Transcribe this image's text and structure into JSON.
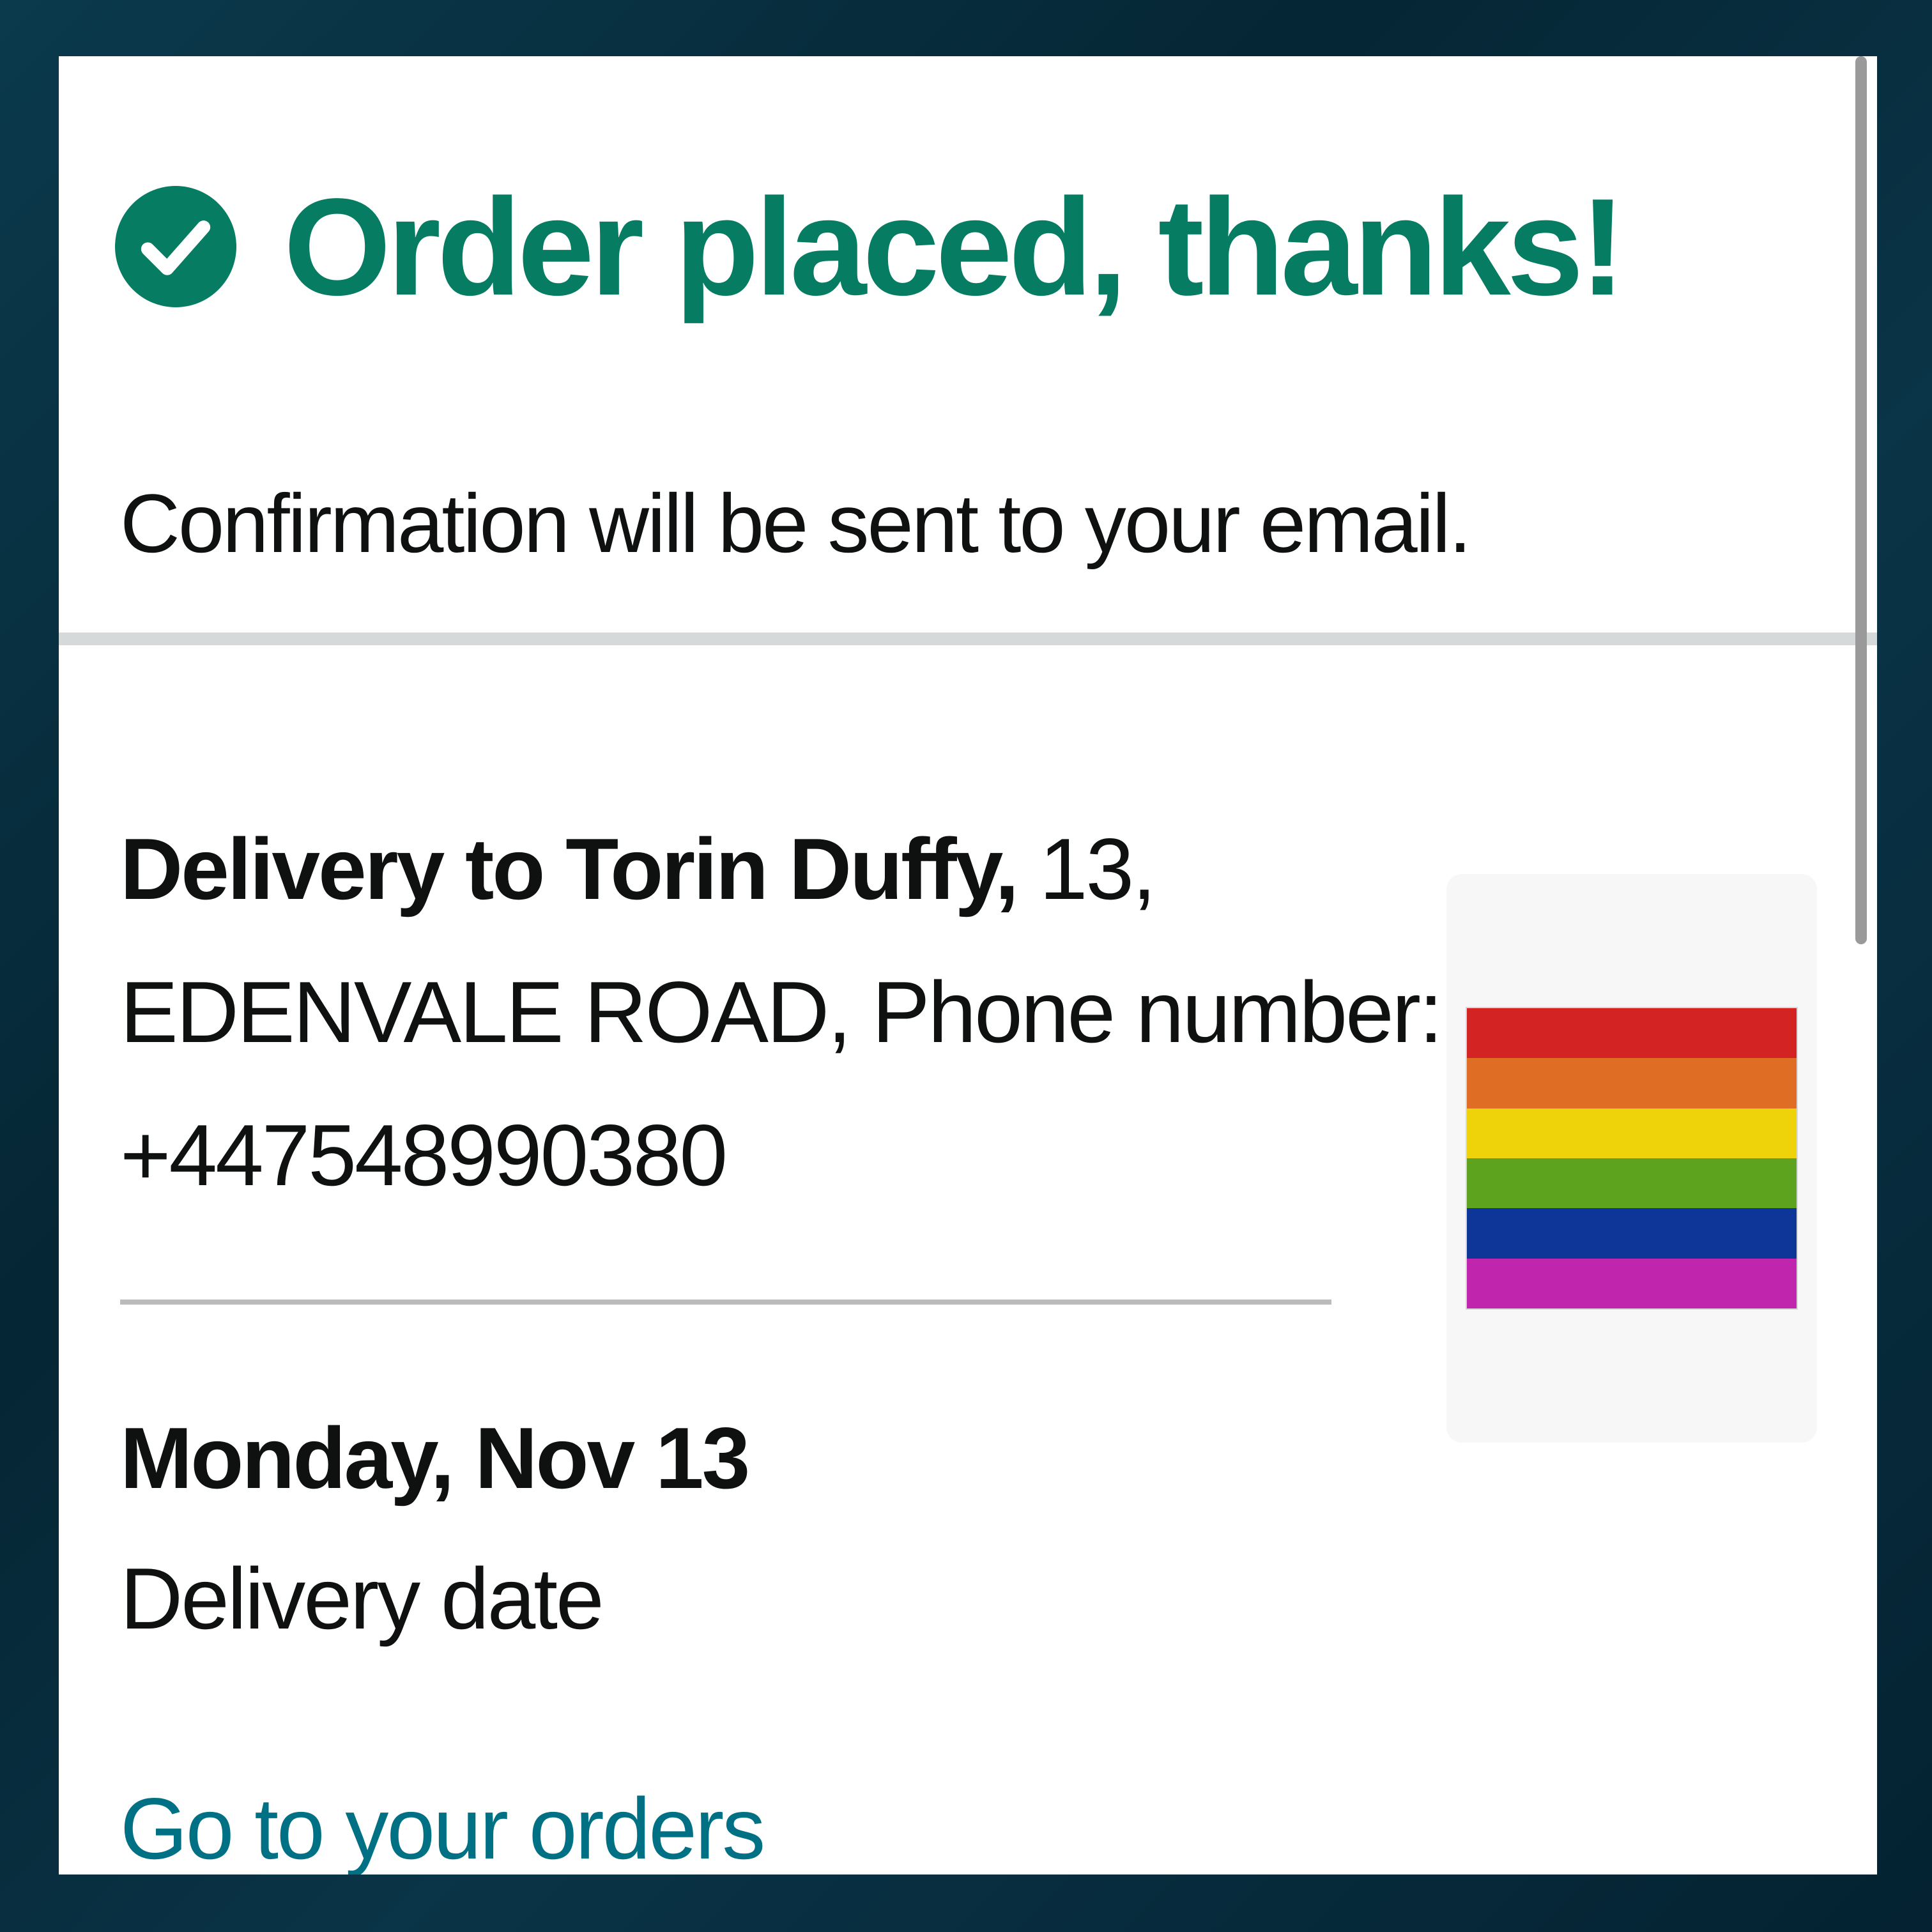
{
  "header": {
    "icon": "check-circle-icon",
    "title": "Order placed, thanks!",
    "confirmation": "Confirmation will be sent to your email."
  },
  "delivery": {
    "label_prefix": "Delivery to ",
    "name": "Torin Duffy,",
    "address_part1": " 13,",
    "address_line2": "EDENVALE ROAD, Phone number:",
    "phone": "+447548990380",
    "date": "Monday, Nov 13",
    "date_label": "Delivery date"
  },
  "actions": {
    "orders_link": "Go to your orders"
  },
  "product": {
    "image": "rainbow-flag",
    "stripe_colors": [
      "#d42323",
      "#e06d24",
      "#eed20a",
      "#5ea31d",
      "#0e3598",
      "#c026ad"
    ]
  },
  "colors": {
    "success": "#067d62",
    "link": "#007185",
    "text": "#0f1111"
  }
}
